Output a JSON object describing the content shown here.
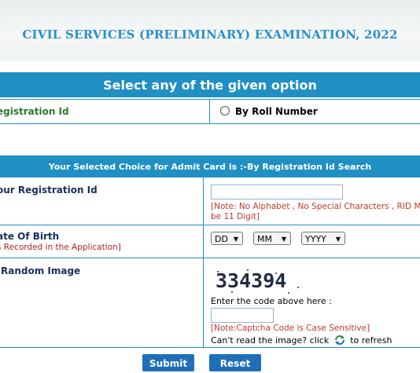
{
  "header": {
    "exam_title": "CIVIL SERVICES (PRELIMINARY) EXAMINATION, 2022"
  },
  "options": {
    "heading": "Select any of the given option",
    "registration_id_label": "egistration Id",
    "roll_number_label": "By Roll Number"
  },
  "form": {
    "choice_heading": "Your Selected Choice for Admit Card is :-By Registration Id Search",
    "registration": {
      "label": "our Registration Id",
      "value": "",
      "note_line1": "[Note: No Alphabet , No Special Characters , RID M",
      "note_line2": "be 11 Digit]"
    },
    "dob": {
      "label": "ate Of Birth",
      "sublabel": "s Recorded in the Application]",
      "day": "DD",
      "month": "MM",
      "year": "YYYY"
    },
    "captcha": {
      "label": "Random Image",
      "code": "334394",
      "enter_prompt": "Enter the code above here :",
      "input_value": "",
      "case_note": "[Note:Captcha Code is Case Sensitive]",
      "refresh_prefix": "Can't read the image? click",
      "refresh_suffix": "to refresh"
    }
  },
  "buttons": {
    "submit": "Submit",
    "reset": "Reset"
  },
  "colors": {
    "accent": "#1f8fc4",
    "title": "#2a8fcc",
    "note": "#c0392b",
    "button": "#1f6fb8"
  }
}
